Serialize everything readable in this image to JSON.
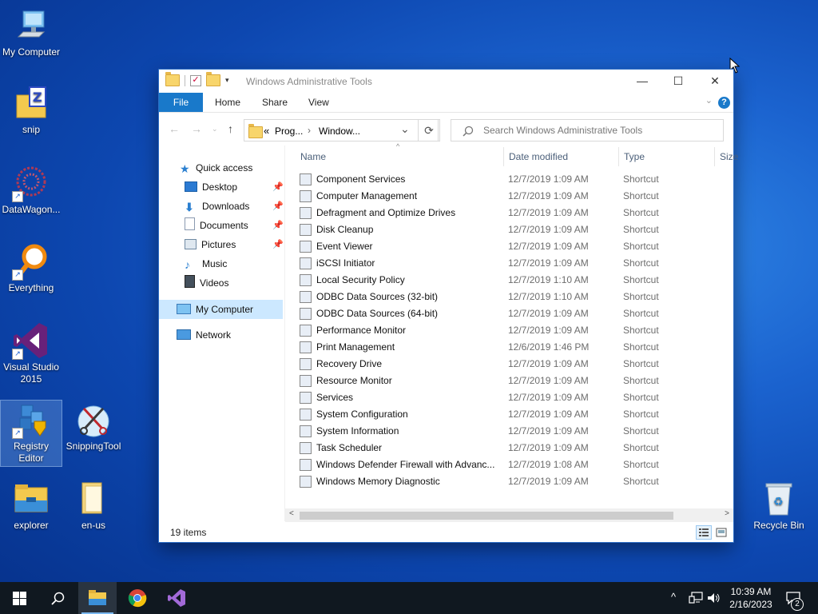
{
  "desktop": {
    "icons": [
      {
        "label": "My Computer"
      },
      {
        "label": "snip"
      },
      {
        "label": "DataWagon..."
      },
      {
        "label": "Everything"
      },
      {
        "label_line1": "Visual Studio",
        "label_line2": "2015"
      },
      {
        "label_line1": "Registry",
        "label_line2": "Editor"
      },
      {
        "label": "SnippingTool"
      },
      {
        "label": "explorer"
      },
      {
        "label": "en-us"
      },
      {
        "label": "Recycle Bin"
      }
    ]
  },
  "window": {
    "title": "Windows Administrative Tools",
    "controls": {
      "minimize": "—",
      "maximize": "☐",
      "close": "✕"
    },
    "ribbon": {
      "file": "File",
      "home": "Home",
      "share": "Share",
      "view": "View",
      "help": "?"
    },
    "address": {
      "chevrons": "«",
      "part1": "Prog...",
      "sep": "›",
      "part2": "Window...",
      "dropdown": "⌄"
    },
    "search_placeholder": "Search Windows Administrative Tools",
    "nav": {
      "quick_access": "Quick access",
      "desktop": "Desktop",
      "downloads": "Downloads",
      "documents": "Documents",
      "pictures": "Pictures",
      "music": "Music",
      "videos": "Videos",
      "my_computer": "My Computer",
      "network": "Network"
    },
    "columns": {
      "name": "Name",
      "date": "Date modified",
      "type": "Type",
      "size": "Size"
    },
    "files": [
      {
        "name": "Component Services",
        "date": "12/7/2019 1:09 AM",
        "type": "Shortcut"
      },
      {
        "name": "Computer Management",
        "date": "12/7/2019 1:09 AM",
        "type": "Shortcut"
      },
      {
        "name": "Defragment and Optimize Drives",
        "date": "12/7/2019 1:09 AM",
        "type": "Shortcut"
      },
      {
        "name": "Disk Cleanup",
        "date": "12/7/2019 1:09 AM",
        "type": "Shortcut"
      },
      {
        "name": "Event Viewer",
        "date": "12/7/2019 1:09 AM",
        "type": "Shortcut"
      },
      {
        "name": "iSCSI Initiator",
        "date": "12/7/2019 1:09 AM",
        "type": "Shortcut"
      },
      {
        "name": "Local Security Policy",
        "date": "12/7/2019 1:10 AM",
        "type": "Shortcut"
      },
      {
        "name": "ODBC Data Sources (32-bit)",
        "date": "12/7/2019 1:10 AM",
        "type": "Shortcut"
      },
      {
        "name": "ODBC Data Sources (64-bit)",
        "date": "12/7/2019 1:09 AM",
        "type": "Shortcut"
      },
      {
        "name": "Performance Monitor",
        "date": "12/7/2019 1:09 AM",
        "type": "Shortcut"
      },
      {
        "name": "Print Management",
        "date": "12/6/2019 1:46 PM",
        "type": "Shortcut"
      },
      {
        "name": "Recovery Drive",
        "date": "12/7/2019 1:09 AM",
        "type": "Shortcut"
      },
      {
        "name": "Resource Monitor",
        "date": "12/7/2019 1:09 AM",
        "type": "Shortcut"
      },
      {
        "name": "Services",
        "date": "12/7/2019 1:09 AM",
        "type": "Shortcut"
      },
      {
        "name": "System Configuration",
        "date": "12/7/2019 1:09 AM",
        "type": "Shortcut"
      },
      {
        "name": "System Information",
        "date": "12/7/2019 1:09 AM",
        "type": "Shortcut"
      },
      {
        "name": "Task Scheduler",
        "date": "12/7/2019 1:09 AM",
        "type": "Shortcut"
      },
      {
        "name": "Windows Defender Firewall with Advanc...",
        "date": "12/7/2019 1:08 AM",
        "type": "Shortcut"
      },
      {
        "name": "Windows Memory Diagnostic",
        "date": "12/7/2019 1:09 AM",
        "type": "Shortcut"
      }
    ],
    "status": "19 items"
  },
  "taskbar": {
    "time": "10:39 AM",
    "date": "2/16/2023",
    "notification_count": "2",
    "tray_chevron": "^"
  },
  "colors": {
    "accent": "#1979ca",
    "taskbar": "#101820"
  }
}
